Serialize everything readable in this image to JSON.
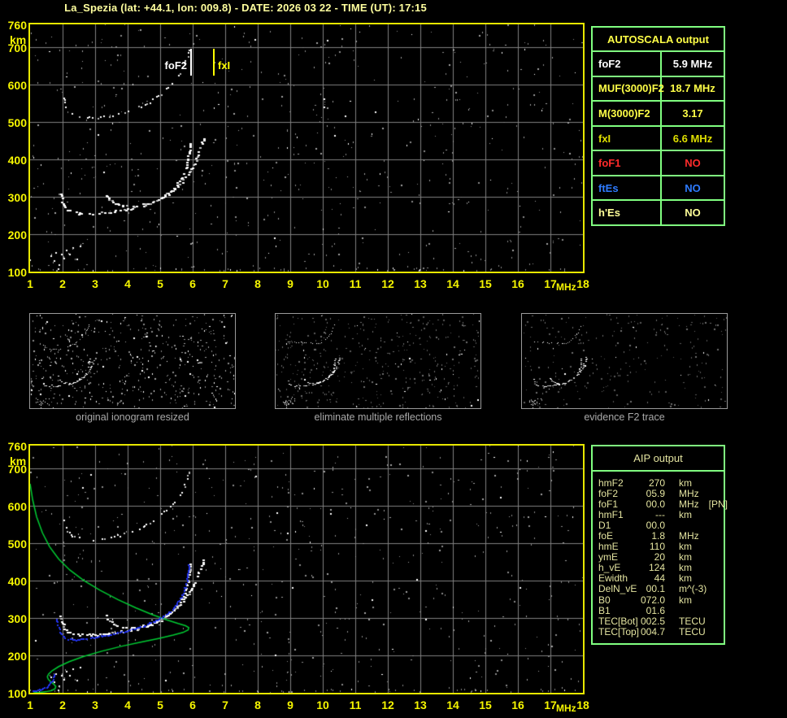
{
  "title": "La_Spezia (lat: +44.1, lon: 009.8) - DATE: 2026 03 22 - TIME (UT): 17:15",
  "plot_markers": {
    "fof2_label": "foF2",
    "fxi_label": "fxI"
  },
  "axes": {
    "x_unit": "MHz",
    "y_unit": "km",
    "x_ticks": [
      "1",
      "2",
      "3",
      "4",
      "5",
      "6",
      "7",
      "8",
      "9",
      "10",
      "11",
      "12",
      "13",
      "14",
      "15",
      "16",
      "17",
      "18"
    ],
    "y_ticks": [
      "760",
      "700",
      "600",
      "500",
      "400",
      "300",
      "200",
      "100"
    ]
  },
  "autoscala": {
    "header": "AUTOSCALA output",
    "rows": [
      {
        "label": "foF2",
        "value": "5.9 MHz",
        "color": "#FFFFFF"
      },
      {
        "label": "MUF(3000)F2",
        "value": "18.7 MHz",
        "color": "#FFFF47"
      },
      {
        "label": "M(3000)F2",
        "value": "3.17",
        "color": "#FFFF47"
      },
      {
        "label": "fxI",
        "value": "6.6 MHz",
        "color": "#DFDF00"
      },
      {
        "label": "foF1",
        "value": "NO",
        "color": "#FF2B2B"
      },
      {
        "label": "ftEs",
        "value": "NO",
        "color": "#2E7BFF"
      },
      {
        "label": "h'Es",
        "value": "NO",
        "color": "#FFFF99"
      }
    ]
  },
  "panels": {
    "captions": [
      "original ionogram resized",
      "eliminate multiple reflections",
      "evidence F2 trace"
    ]
  },
  "aip": {
    "header": "AIP output",
    "rows": [
      {
        "label": "hmF2",
        "value": "270",
        "unit": "km",
        "extra": ""
      },
      {
        "label": "foF2",
        "value": "05.9",
        "unit": "MHz",
        "extra": ""
      },
      {
        "label": "foF1",
        "value": "00.0",
        "unit": "MHz",
        "extra": "[PN]"
      },
      {
        "label": "hmF1",
        "value": "---",
        "unit": "km",
        "extra": ""
      },
      {
        "label": "D1",
        "value": "00.0",
        "unit": "",
        "extra": ""
      },
      {
        "label": "foE",
        "value": "1.8",
        "unit": "MHz",
        "extra": ""
      },
      {
        "label": "hmE",
        "value": "110",
        "unit": "km",
        "extra": ""
      },
      {
        "label": "ymE",
        "value": "20",
        "unit": "km",
        "extra": ""
      },
      {
        "label": "h_vE",
        "value": "124",
        "unit": "km",
        "extra": ""
      },
      {
        "label": "Ewidth",
        "value": "44",
        "unit": "km",
        "extra": ""
      },
      {
        "label": "DelN_vE",
        "value": "00.1",
        "unit": "m^(-3)",
        "extra": ""
      },
      {
        "label": "B0",
        "value": "072.0",
        "unit": "km",
        "extra": ""
      },
      {
        "label": "B1",
        "value": "01.6",
        "unit": "",
        "extra": ""
      },
      {
        "label": "TEC[Bot]",
        "value": "002.5",
        "unit": "TECU",
        "extra": ""
      },
      {
        "label": "TEC[Top]",
        "value": "004.7",
        "unit": "TECU",
        "extra": ""
      }
    ]
  },
  "colors": {
    "frame_yellow": "#E8E800",
    "tick_label_yellow": "#F5F500",
    "grid_gray": "#808080",
    "trace_white": "#FFFFFF",
    "model_blue": "#2233EE",
    "profile_green": "#00CC33",
    "table_border_green": "#80FF80",
    "marker_fof2": "#FFFFFF",
    "marker_fxi": "#FFFF00",
    "caption_gray": "#A9A9A9",
    "title_yellow": "#FFFF9E"
  },
  "chart_data": {
    "type": "scatter",
    "xlabel": "MHz",
    "ylabel": "km",
    "xlim": [
      1,
      18
    ],
    "ylim": [
      100,
      760
    ],
    "grid": true,
    "plots": [
      {
        "name": "autoscala_scaled_ionogram",
        "series": [
          "f2_ordinary",
          "f2_extraordinary",
          "second_hop",
          "e_region_scatter"
        ],
        "markers": [
          {
            "label": "foF2",
            "x_mhz": 5.9
          },
          {
            "label": "fxI",
            "x_mhz": 6.6
          }
        ]
      },
      {
        "name": "aip_ionogram_with_profile",
        "series": [
          "f2_ordinary",
          "f2_extraordinary",
          "second_hop",
          "e_region_scatter",
          "model_trace_blue",
          "model_e_blue",
          "density_profile_green"
        ]
      },
      {
        "name": "original ionogram resized",
        "series": [
          "f2_ordinary",
          "f2_extraordinary",
          "second_hop",
          "e_region_scatter"
        ]
      },
      {
        "name": "eliminate multiple reflections",
        "series": [
          "f2_ordinary",
          "f2_extraordinary",
          "second_hop_cusp_only",
          "e_region_scatter"
        ]
      },
      {
        "name": "evidence F2 trace",
        "series": [
          "f2_ordinary",
          "f2_extraordinary",
          "second_hop_cusp_only",
          "e_region_scatter"
        ]
      }
    ],
    "traces": {
      "f2_ordinary": [
        [
          1.93,
          308
        ],
        [
          1.98,
          288
        ],
        [
          2.05,
          272
        ],
        [
          2.18,
          262
        ],
        [
          2.45,
          257
        ],
        [
          2.85,
          256
        ],
        [
          3.3,
          259
        ],
        [
          3.8,
          264
        ],
        [
          4.25,
          272
        ],
        [
          4.7,
          284
        ],
        [
          5.05,
          300
        ],
        [
          5.35,
          319
        ],
        [
          5.58,
          342
        ],
        [
          5.73,
          369
        ],
        [
          5.82,
          398
        ],
        [
          5.88,
          428
        ],
        [
          5.91,
          455
        ]
      ],
      "f2_extraordinary": [
        [
          3.32,
          306
        ],
        [
          3.42,
          292
        ],
        [
          3.6,
          282
        ],
        [
          3.85,
          276
        ],
        [
          4.2,
          274
        ],
        [
          4.6,
          282
        ],
        [
          5.0,
          296
        ],
        [
          5.35,
          316
        ],
        [
          5.65,
          341
        ],
        [
          5.9,
          370
        ],
        [
          6.08,
          400
        ],
        [
          6.22,
          430
        ],
        [
          6.32,
          458
        ],
        [
          6.37,
          472
        ]
      ],
      "second_hop": [
        [
          2.02,
          566
        ],
        [
          2.1,
          540
        ],
        [
          2.22,
          524
        ],
        [
          2.5,
          514
        ],
        [
          2.9,
          511
        ],
        [
          3.35,
          515
        ],
        [
          3.8,
          524
        ],
        [
          4.25,
          537
        ],
        [
          4.65,
          554
        ],
        [
          5.0,
          575
        ],
        [
          5.3,
          599
        ],
        [
          5.55,
          625
        ],
        [
          5.72,
          650
        ],
        [
          5.83,
          675
        ],
        [
          5.89,
          698
        ]
      ],
      "e_region_scatter": [
        [
          1.62,
          143
        ],
        [
          1.72,
          131
        ],
        [
          1.78,
          152
        ],
        [
          1.88,
          120
        ],
        [
          1.95,
          148
        ],
        [
          2.02,
          136
        ],
        [
          2.1,
          158
        ],
        [
          2.2,
          147
        ],
        [
          2.3,
          166
        ],
        [
          2.42,
          135
        ],
        [
          2.52,
          170
        ],
        [
          1.85,
          108
        ]
      ],
      "model_trace_blue": [
        [
          1.8,
          298
        ],
        [
          1.86,
          274
        ],
        [
          1.95,
          256
        ],
        [
          2.1,
          246
        ],
        [
          2.35,
          242
        ],
        [
          2.65,
          245
        ],
        [
          3.0,
          250
        ],
        [
          3.45,
          257
        ],
        [
          3.95,
          266
        ],
        [
          4.45,
          279
        ],
        [
          4.9,
          296
        ],
        [
          5.25,
          315
        ],
        [
          5.5,
          338
        ],
        [
          5.68,
          364
        ],
        [
          5.79,
          393
        ],
        [
          5.85,
          423
        ],
        [
          5.88,
          448
        ]
      ],
      "model_e_blue": [
        [
          1.08,
          106
        ],
        [
          1.22,
          108
        ],
        [
          1.35,
          111
        ],
        [
          1.48,
          116
        ],
        [
          1.58,
          124
        ],
        [
          1.66,
          134
        ],
        [
          1.71,
          146
        ],
        [
          1.73,
          156
        ]
      ],
      "density_profile_green": [
        [
          1.0,
          658
        ],
        [
          1.08,
          615
        ],
        [
          1.2,
          570
        ],
        [
          1.38,
          527
        ],
        [
          1.6,
          490
        ],
        [
          1.88,
          457
        ],
        [
          2.22,
          428
        ],
        [
          2.65,
          400
        ],
        [
          3.15,
          374
        ],
        [
          3.7,
          349
        ],
        [
          4.25,
          327
        ],
        [
          4.75,
          309
        ],
        [
          5.2,
          295
        ],
        [
          5.55,
          285
        ],
        [
          5.78,
          279
        ],
        [
          5.88,
          274
        ],
        [
          5.86,
          268
        ],
        [
          5.7,
          261
        ],
        [
          5.4,
          254
        ],
        [
          4.95,
          245
        ],
        [
          4.4,
          235
        ],
        [
          3.8,
          224
        ],
        [
          3.2,
          211
        ],
        [
          2.65,
          197
        ],
        [
          2.2,
          183
        ],
        [
          1.88,
          170
        ],
        [
          1.68,
          159
        ],
        [
          1.57,
          150
        ],
        [
          1.53,
          143
        ],
        [
          1.56,
          136
        ],
        [
          1.64,
          129
        ],
        [
          1.73,
          123
        ],
        [
          1.79,
          117
        ],
        [
          1.77,
          111
        ],
        [
          1.66,
          106
        ],
        [
          1.5,
          103
        ],
        [
          1.3,
          101
        ],
        [
          1.1,
          100
        ]
      ]
    }
  }
}
